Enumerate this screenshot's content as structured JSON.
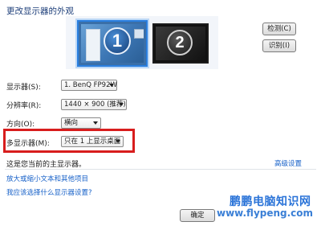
{
  "title": "更改显示器的外观",
  "monitors": [
    {
      "number": "1",
      "selected": true
    },
    {
      "number": "2",
      "selected": false
    }
  ],
  "buttons": {
    "detect": "检测(C)",
    "identify": "识别(I)",
    "ok": "确定"
  },
  "settings": {
    "display_label": "显示器(S):",
    "display_value": "1. BenQ FP92W",
    "resolution_label": "分辨率(R):",
    "resolution_value": "1440 × 900 (推荐)",
    "orientation_label": "方向(O):",
    "orientation_value": "横向",
    "multi_label": "多显示器(M):",
    "multi_value": "只在 1 上显示桌面"
  },
  "primary_note": "这是您当前的主显示器。",
  "links": {
    "advanced": "高级设置",
    "text_size": "放大或缩小文本和其他项目",
    "which_settings": "我应该选择什么显示器设置?"
  },
  "watermark": {
    "name": "鹏鹏电脑知识网",
    "url": "www.flypeng.com"
  },
  "colors": {
    "highlight": "#d81d1d",
    "link": "#1660c8",
    "selected_monitor": "#2a7fe0"
  }
}
